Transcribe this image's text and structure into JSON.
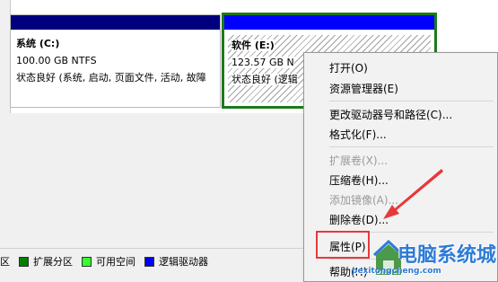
{
  "partitions": [
    {
      "name": "系统  (C:)",
      "size": "100.00 GB NTFS",
      "status": "状态良好 (系统, 启动, 页面文件, 活动, 故障"
    },
    {
      "name": "软件  (E:)",
      "size": "123.57 GB N",
      "status": "状态良好 (逻辑"
    }
  ],
  "legend": {
    "items": [
      {
        "label": "区",
        "color": "",
        "has_swatch": false
      },
      {
        "label": "扩展分区",
        "color": "#007f00"
      },
      {
        "label": "可用空间",
        "color": "#33ff33"
      },
      {
        "label": "逻辑驱动器",
        "color": "#0000ff"
      }
    ]
  },
  "context_menu": {
    "items": [
      {
        "label": "打开(O)",
        "enabled": true
      },
      {
        "label": "资源管理器(E)",
        "enabled": true
      },
      {
        "label": "更改驱动器号和路径(C)...",
        "enabled": true
      },
      {
        "label": "格式化(F)...",
        "enabled": true
      },
      {
        "label": "扩展卷(X)...",
        "enabled": false
      },
      {
        "label": "压缩卷(H)...",
        "enabled": true
      },
      {
        "label": "添加镜像(A)...",
        "enabled": false
      },
      {
        "label": "删除卷(D)...",
        "enabled": true
      },
      {
        "label": "属性(P)",
        "enabled": true
      },
      {
        "label": "帮助(H)",
        "enabled": true
      }
    ]
  },
  "watermark": {
    "title": "电脑系统城",
    "url": "pexitongcheng.com"
  },
  "colors": {
    "highlight": "#e8383a",
    "primary_bar": "#00007f",
    "logical_bar": "#0000ff",
    "selection_border": "#1b7a1b"
  }
}
